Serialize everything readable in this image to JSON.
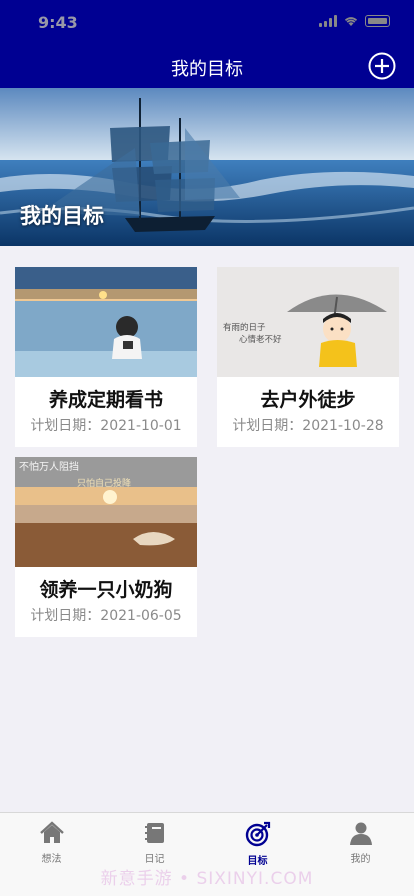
{
  "status_bar": {
    "time": "9:43"
  },
  "nav": {
    "title": "我的目标",
    "add_icon": "plus-circle-icon"
  },
  "banner": {
    "title": "我的目标"
  },
  "goals": [
    {
      "title": "养成定期看书",
      "date": "计划日期：2021-10-01"
    },
    {
      "title": "去户外徒步",
      "date": "计划日期：2021-10-28"
    },
    {
      "title": "领养一只小奶狗",
      "date": "计划日期：2021-06-05"
    }
  ],
  "card2_image_text": {
    "line1": "有雨的日子",
    "line2": "心情老不好"
  },
  "card3_image_text": {
    "line1": "不怕万人阻挡",
    "line2": "只怕自己投降"
  },
  "tabs": [
    {
      "label": "想法",
      "icon": "home-icon"
    },
    {
      "label": "日记",
      "icon": "notebook-icon"
    },
    {
      "label": "目标",
      "icon": "target-icon"
    },
    {
      "label": "我的",
      "icon": "person-icon"
    }
  ],
  "active_tab": "目标",
  "watermark": "新意手游 • SIXINYI.COM",
  "colors": {
    "nav_background": "#000092",
    "page_background": "#f1f0f6",
    "active_tab": "#000092"
  }
}
